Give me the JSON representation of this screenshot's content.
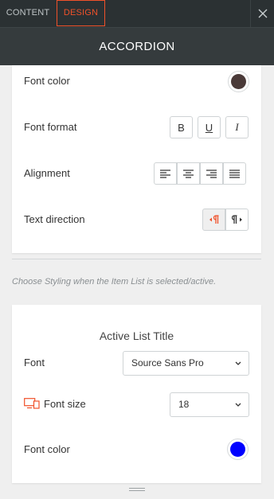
{
  "tabs": [
    {
      "label": "CONTENT"
    },
    {
      "label": "DESIGN"
    }
  ],
  "header": {
    "title": "ACCORDION"
  },
  "design": {
    "font_color": {
      "label": "Font color",
      "value": "#4a3a38"
    },
    "font_format": {
      "label": "Font format",
      "buttons": [
        "B",
        "U",
        "I"
      ]
    },
    "alignment": {
      "label": "Alignment"
    },
    "text_direction": {
      "label": "Text direction"
    }
  },
  "note": "Choose Styling when the Item List is selected/active.",
  "active_list": {
    "title": "Active List Title",
    "font": {
      "label": "Font",
      "value": "Source Sans Pro"
    },
    "font_size": {
      "label": "Font size",
      "value": "18"
    },
    "font_color": {
      "label": "Font color",
      "value": "#0000ff"
    }
  },
  "colors": {
    "accent": "#f0512a",
    "dark_bar": "#2b3133",
    "header_bg": "#353b3d"
  }
}
